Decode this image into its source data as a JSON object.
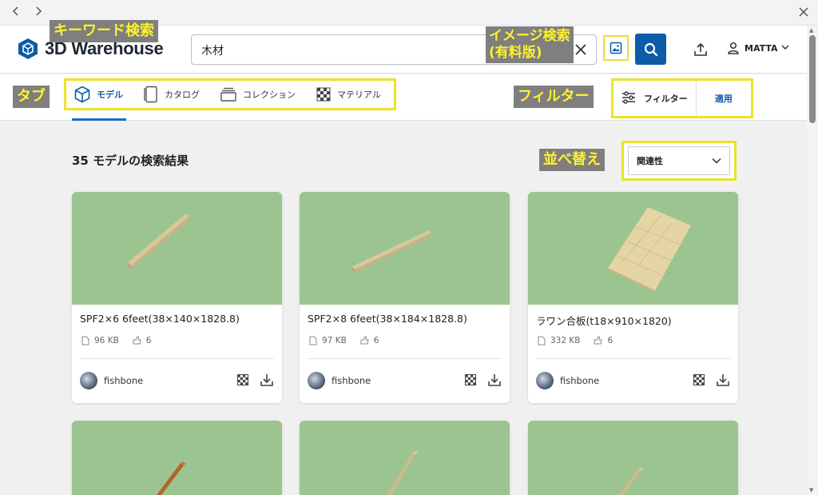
{
  "window": {
    "back_icon": "chevron-left-icon",
    "forward_icon": "chevron-right-icon",
    "close_icon": "close-icon"
  },
  "header": {
    "logo_text": "3D Warehouse",
    "search": {
      "value": "木材",
      "clear_icon": "close-icon"
    },
    "user_name": "MATTA"
  },
  "tabs": [
    {
      "label": "モデル",
      "icon": "cube-icon",
      "active": true
    },
    {
      "label": "カタログ",
      "icon": "catalog-icon",
      "active": false
    },
    {
      "label": "コレクション",
      "icon": "collection-icon",
      "active": false
    },
    {
      "label": "マテリアル",
      "icon": "material-icon",
      "active": false
    }
  ],
  "filter": {
    "label": "フィルター",
    "apply_label": "適用"
  },
  "results": {
    "title": "35 モデルの検索結果",
    "sort_value": "関連性"
  },
  "annotations": {
    "keyword": "キーワード検索",
    "image_search_line1": "イメージ検索",
    "image_search_line2": "(有料版)",
    "tabs": "タブ",
    "filter": "フィルター",
    "sort": "並べ替え"
  },
  "cards": [
    {
      "title": "SPF2×6 6feet(38×140×1828.8)",
      "size": "96 KB",
      "likes": "6",
      "author": "fishbone"
    },
    {
      "title": "SPF2×8 6feet(38×184×1828.8)",
      "size": "97 KB",
      "likes": "6",
      "author": "fishbone"
    },
    {
      "title": "ラワン合板(t18×910×1820)",
      "size": "332 KB",
      "likes": "6",
      "author": "fishbone"
    },
    {
      "title": "",
      "size": "",
      "likes": "",
      "author": ""
    },
    {
      "title": "",
      "size": "",
      "likes": "",
      "author": ""
    },
    {
      "title": "",
      "size": "",
      "likes": "",
      "author": ""
    }
  ],
  "colors": {
    "brand_blue": "#0e5ba7",
    "highlight_yellow": "#ece22b",
    "annotation_bg": "#7f7f7f",
    "annotation_text": "#fff22c",
    "thumb_green": "#9cc490"
  }
}
